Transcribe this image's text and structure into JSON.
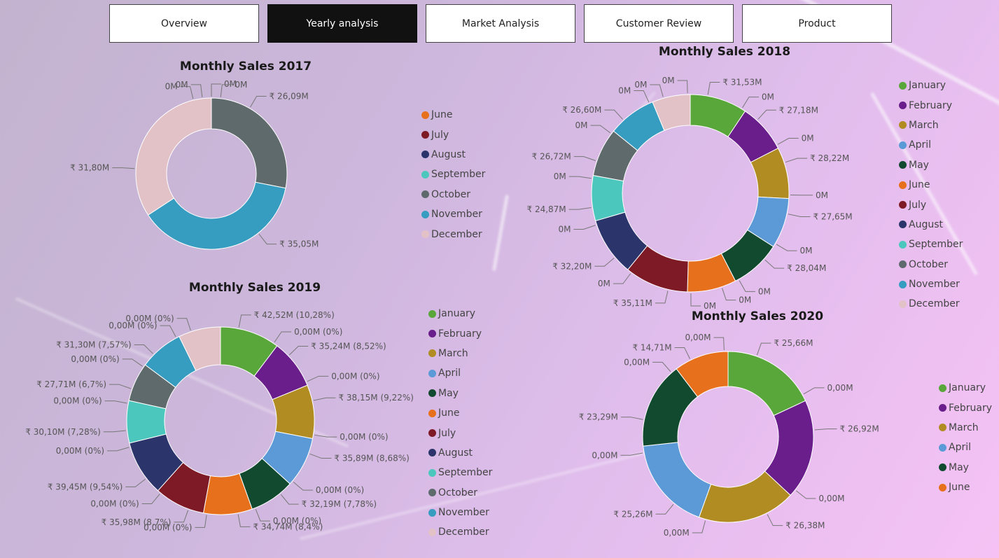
{
  "nav": {
    "tabs": [
      {
        "label": "Overview",
        "active": false
      },
      {
        "label": "Yearly analysis",
        "active": true
      },
      {
        "label": "Market Analysis",
        "active": false
      },
      {
        "label": "Customer Review",
        "active": false
      },
      {
        "label": "Product",
        "active": false
      }
    ]
  },
  "month_colors": {
    "January": "#59a63b",
    "February": "#6a1e8b",
    "March": "#b08c22",
    "April": "#5b9ad6",
    "May": "#114a2f",
    "June": "#e7701d",
    "July": "#7e1a25",
    "August": "#2b356b",
    "September": "#4cc7bd",
    "October": "#5f6a6c",
    "November": "#369cc0",
    "December": "#e2c2c6"
  },
  "chart_data": [
    {
      "type": "pie",
      "title": "Monthly Sales 2017",
      "legend": [
        "June",
        "July",
        "August",
        "September",
        "October",
        "November",
        "December"
      ],
      "slices": [
        {
          "label": "June",
          "value": 0,
          "display": "0M"
        },
        {
          "label": "July",
          "value": 0,
          "display": "0M"
        },
        {
          "label": "August",
          "value": 0,
          "display": "0M"
        },
        {
          "label": "September",
          "value": 0,
          "display": "0M"
        },
        {
          "label": "October",
          "value": 26.09,
          "display": "₹ 26,09M"
        },
        {
          "label": "November",
          "value": 35.05,
          "display": "₹ 35,05M"
        },
        {
          "label": "December",
          "value": 31.8,
          "display": "₹ 31,80M"
        }
      ]
    },
    {
      "type": "pie",
      "title": "Monthly Sales 2018",
      "legend": [
        "January",
        "February",
        "March",
        "April",
        "May",
        "June",
        "July",
        "August",
        "September",
        "October",
        "November",
        "December"
      ],
      "slices": [
        {
          "label": "January",
          "value": 31.53,
          "display": "₹ 31,53M"
        },
        {
          "label": "February",
          "value": 27.18,
          "display": "₹ 27,18M"
        },
        {
          "label": "March",
          "value": 28.22,
          "display": "₹ 28,22M"
        },
        {
          "label": "April",
          "value": 27.65,
          "display": "₹ 27,65M"
        },
        {
          "label": "May",
          "value": 28.04,
          "display": "₹ 28,04M"
        },
        {
          "label": "June",
          "value": 27.0,
          "display": "0M"
        },
        {
          "label": "July",
          "value": 35.11,
          "display": "₹ 35,11M"
        },
        {
          "label": "August",
          "value": 32.2,
          "display": "₹ 32,20M"
        },
        {
          "label": "September",
          "value": 24.87,
          "display": "₹ 24,87M"
        },
        {
          "label": "October",
          "value": 26.72,
          "display": "₹ 26,72M"
        },
        {
          "label": "November",
          "value": 26.6,
          "display": "₹ 26,60M"
        },
        {
          "label": "December",
          "value": 21.0,
          "display": "0M"
        }
      ],
      "zero_labels": [
        "0M",
        "0M",
        "0M",
        "0M",
        "0M",
        "0M",
        "0M",
        "0M",
        "0M",
        "0M",
        "0M",
        "0M"
      ]
    },
    {
      "type": "pie",
      "title": "Monthly Sales 2019",
      "legend": [
        "January",
        "February",
        "March",
        "April",
        "May",
        "June",
        "July",
        "August",
        "September",
        "October",
        "November",
        "December"
      ],
      "slices": [
        {
          "label": "January",
          "value": 42.52,
          "display": "₹ 42,52M (10,28%)"
        },
        {
          "label": "February",
          "value": 35.24,
          "display": "₹ 35,24M (8,52%)"
        },
        {
          "label": "March",
          "value": 38.15,
          "display": "₹ 38,15M (9,22%)"
        },
        {
          "label": "April",
          "value": 35.89,
          "display": "₹ 35,89M (8,68%)"
        },
        {
          "label": "May",
          "value": 32.19,
          "display": "₹ 32,19M (7,78%)"
        },
        {
          "label": "June",
          "value": 34.74,
          "display": "₹ 34,74M (8,4%)"
        },
        {
          "label": "July",
          "value": 35.98,
          "display": "₹ 35,98M (8,7%)"
        },
        {
          "label": "August",
          "value": 39.45,
          "display": "₹ 39,45M (9,54%)"
        },
        {
          "label": "September",
          "value": 30.1,
          "display": "₹ 30,10M (7,28%)"
        },
        {
          "label": "October",
          "value": 27.71,
          "display": "₹ 27,71M (6,7%)"
        },
        {
          "label": "November",
          "value": 31.3,
          "display": "₹ 31,30M (7,57%)"
        },
        {
          "label": "December",
          "value": 30.0,
          "display": "0,00M (0%)"
        }
      ],
      "zero_labels": [
        "0,00M (0%)",
        "0,00M (0%)",
        "0,00M (0%)",
        "0,00M (0%)",
        "0,00M (0%)",
        "0,00M (0%)",
        "0,00M (0%)",
        "0,00M (0%)",
        "0,00M (0%)",
        "0,00M (0%)",
        "0,00M (0%)"
      ]
    },
    {
      "type": "pie",
      "title": "Monthly Sales 2020",
      "legend": [
        "January",
        "February",
        "March",
        "April",
        "May",
        "June"
      ],
      "slices": [
        {
          "label": "January",
          "value": 25.66,
          "display": "₹ 25,66M"
        },
        {
          "label": "February",
          "value": 26.92,
          "display": "₹ 26,92M"
        },
        {
          "label": "March",
          "value": 26.38,
          "display": "₹ 26,38M"
        },
        {
          "label": "April",
          "value": 25.26,
          "display": "₹ 25,26M"
        },
        {
          "label": "May",
          "value": 23.29,
          "display": "₹ 23,29M"
        },
        {
          "label": "June",
          "value": 14.71,
          "display": "₹ 14,71M"
        }
      ],
      "zero_labels": [
        "0,00M",
        "0,00M",
        "0,00M",
        "0,00M",
        "0,00M",
        "0,00M"
      ]
    }
  ]
}
